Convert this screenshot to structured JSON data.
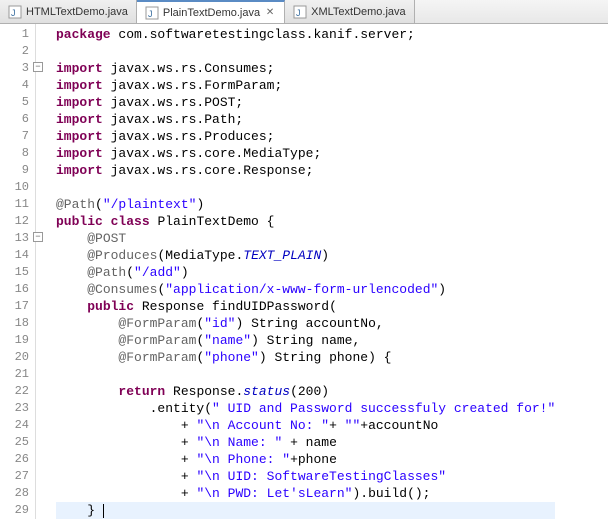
{
  "tabs": [
    {
      "label": "HTMLTextDemo.java",
      "active": false
    },
    {
      "label": "PlainTextDemo.java",
      "active": true
    },
    {
      "label": "XMLTextDemo.java",
      "active": false
    }
  ],
  "code": {
    "lines": [
      {
        "n": 1,
        "tokens": [
          [
            "kw",
            "package"
          ],
          [
            "",
            " com.softwaretestingclass.kanif.server;"
          ]
        ]
      },
      {
        "n": 2,
        "tokens": [
          [
            "",
            ""
          ]
        ]
      },
      {
        "n": 3,
        "fold": true,
        "tokens": [
          [
            "kw",
            "import"
          ],
          [
            "",
            " javax.ws.rs.Consumes;"
          ]
        ]
      },
      {
        "n": 4,
        "tokens": [
          [
            "kw",
            "import"
          ],
          [
            "",
            " javax.ws.rs.FormParam;"
          ]
        ]
      },
      {
        "n": 5,
        "tokens": [
          [
            "kw",
            "import"
          ],
          [
            "",
            " javax.ws.rs.POST;"
          ]
        ]
      },
      {
        "n": 6,
        "tokens": [
          [
            "kw",
            "import"
          ],
          [
            "",
            " javax.ws.rs.Path;"
          ]
        ]
      },
      {
        "n": 7,
        "tokens": [
          [
            "kw",
            "import"
          ],
          [
            "",
            " javax.ws.rs.Produces;"
          ]
        ]
      },
      {
        "n": 8,
        "tokens": [
          [
            "kw",
            "import"
          ],
          [
            "",
            " javax.ws.rs.core.MediaType;"
          ]
        ]
      },
      {
        "n": 9,
        "tokens": [
          [
            "kw",
            "import"
          ],
          [
            "",
            " javax.ws.rs.core.Response;"
          ]
        ]
      },
      {
        "n": 10,
        "tokens": [
          [
            "",
            ""
          ]
        ]
      },
      {
        "n": 11,
        "tokens": [
          [
            "ann",
            "@Path"
          ],
          [
            "",
            "("
          ],
          [
            "str",
            "\"/plaintext\""
          ],
          [
            "",
            ")"
          ]
        ]
      },
      {
        "n": 12,
        "tokens": [
          [
            "kw",
            "public"
          ],
          [
            "",
            " "
          ],
          [
            "kw",
            "class"
          ],
          [
            "",
            " PlainTextDemo {"
          ]
        ]
      },
      {
        "n": 13,
        "fold": true,
        "tokens": [
          [
            "",
            "    "
          ],
          [
            "ann",
            "@POST"
          ]
        ]
      },
      {
        "n": 14,
        "tokens": [
          [
            "",
            "    "
          ],
          [
            "ann",
            "@Produces"
          ],
          [
            "",
            "(MediaType."
          ],
          [
            "static-field",
            "TEXT_PLAIN"
          ],
          [
            "",
            ")"
          ]
        ]
      },
      {
        "n": 15,
        "tokens": [
          [
            "",
            "    "
          ],
          [
            "ann",
            "@Path"
          ],
          [
            "",
            "("
          ],
          [
            "str",
            "\"/add\""
          ],
          [
            "",
            ")"
          ]
        ]
      },
      {
        "n": 16,
        "tokens": [
          [
            "",
            "    "
          ],
          [
            "ann",
            "@Consumes"
          ],
          [
            "",
            "("
          ],
          [
            "str",
            "\"application/x-www-form-urlencoded\""
          ],
          [
            "",
            ")"
          ]
        ]
      },
      {
        "n": 17,
        "tokens": [
          [
            "",
            "    "
          ],
          [
            "kw",
            "public"
          ],
          [
            "",
            " Response findUIDPassword("
          ]
        ]
      },
      {
        "n": 18,
        "tokens": [
          [
            "",
            "        "
          ],
          [
            "ann",
            "@FormParam"
          ],
          [
            "",
            "("
          ],
          [
            "str",
            "\"id\""
          ],
          [
            "",
            ") String accountNo,"
          ]
        ]
      },
      {
        "n": 19,
        "tokens": [
          [
            "",
            "        "
          ],
          [
            "ann",
            "@FormParam"
          ],
          [
            "",
            "("
          ],
          [
            "str",
            "\"name\""
          ],
          [
            "",
            ") String name,"
          ]
        ]
      },
      {
        "n": 20,
        "tokens": [
          [
            "",
            "        "
          ],
          [
            "ann",
            "@FormParam"
          ],
          [
            "",
            "("
          ],
          [
            "str",
            "\"phone\""
          ],
          [
            "",
            ") String phone) {"
          ]
        ]
      },
      {
        "n": 21,
        "tokens": [
          [
            "",
            ""
          ]
        ]
      },
      {
        "n": 22,
        "tokens": [
          [
            "",
            "        "
          ],
          [
            "kw",
            "return"
          ],
          [
            "",
            " Response."
          ],
          [
            "static-field",
            "status"
          ],
          [
            "",
            "(200)"
          ]
        ]
      },
      {
        "n": 23,
        "tokens": [
          [
            "",
            "            .entity("
          ],
          [
            "str",
            "\" UID and Password successfuly created for!\""
          ]
        ]
      },
      {
        "n": 24,
        "tokens": [
          [
            "",
            "                + "
          ],
          [
            "str",
            "\"\\n Account No: \""
          ],
          [
            "",
            "+ "
          ],
          [
            "str",
            "\"\""
          ],
          [
            "",
            "+accountNo"
          ]
        ]
      },
      {
        "n": 25,
        "tokens": [
          [
            "",
            "                + "
          ],
          [
            "str",
            "\"\\n Name: \""
          ],
          [
            "",
            " + name"
          ]
        ]
      },
      {
        "n": 26,
        "tokens": [
          [
            "",
            "                + "
          ],
          [
            "str",
            "\"\\n Phone: \""
          ],
          [
            "",
            "+phone"
          ]
        ]
      },
      {
        "n": 27,
        "tokens": [
          [
            "",
            "                + "
          ],
          [
            "str",
            "\"\\n UID: SoftwareTestingClasses\""
          ]
        ]
      },
      {
        "n": 28,
        "tokens": [
          [
            "",
            "                + "
          ],
          [
            "str",
            "\"\\n PWD: Let'sLearn\""
          ],
          [
            "",
            ").build();"
          ]
        ]
      },
      {
        "n": 29,
        "cursor": true,
        "tokens": [
          [
            "",
            "    } "
          ]
        ]
      }
    ]
  }
}
